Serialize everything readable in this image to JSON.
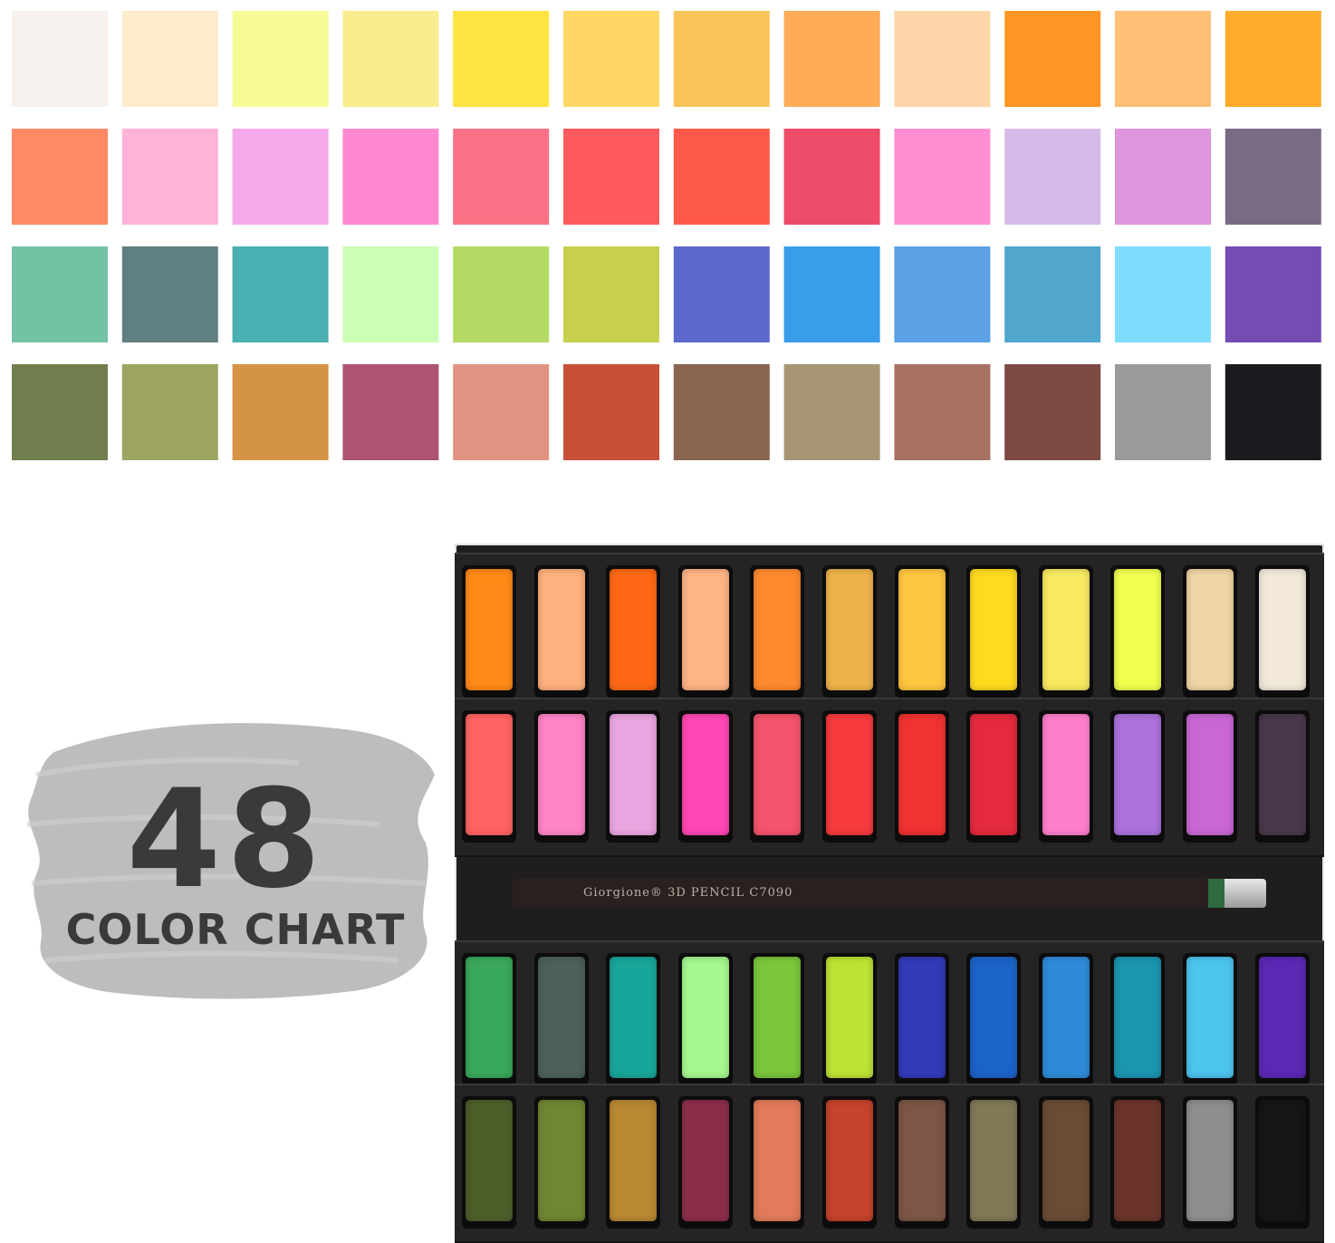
{
  "label": {
    "number": "48",
    "caption": "COLOR CHART",
    "pencil_text": "Giorgione® 3D PENCIL   C7090"
  },
  "colors": {
    "background": "#ffffff",
    "text": "#3a3a3a",
    "brush_stroke": "#bdbdbd",
    "tin": "#1f1d1e"
  },
  "chart_swatches": [
    [
      "#f6f1ec",
      "#fdebc9",
      "#f6fb98",
      "#fbed8f",
      "#ffe340",
      "#ffd762",
      "#f9c45a",
      "#ffab58",
      "#ffd6aa",
      "#ff9524",
      "#ffbf77",
      "#ffab2b"
    ],
    [
      "#ff8964",
      "#ffb3d7",
      "#f7aaeb",
      "#ff88d1",
      "#fb7286",
      "#ff5a5d",
      "#ff5a49",
      "#ee4b69",
      "#ff8fd2",
      "#d5bbe9",
      "#de95dc",
      "#7a6b84"
    ],
    [
      "#74c2a4",
      "#607f80",
      "#4aafb1",
      "#caffb5",
      "#b3db66",
      "#c8cf4d",
      "#5e69cc",
      "#399dea",
      "#5da1e6",
      "#50a6cd",
      "#7fdcff",
      "#744cb3"
    ],
    [
      "#707d4c",
      "#9ea461",
      "#d49345",
      "#ad5473",
      "#e29280",
      "#c95038",
      "#8a6550",
      "#a69673",
      "#a87263",
      "#7c4a43",
      "#9b9b9d",
      "#1b1a1f"
    ]
  ],
  "tin_pans": [
    [
      "#ff8a17",
      "#ffb17e",
      "#ff6915",
      "#ffb486",
      "#ff8a2e",
      "#eeb34b",
      "#ffc640",
      "#ffda1e",
      "#f8ea60",
      "#f1ff4f",
      "#f0d6a4",
      "#f2e9d9"
    ],
    [
      "#ff6462",
      "#ff85c6",
      "#e9a6e0",
      "#ff47b5",
      "#f5546c",
      "#f73a3e",
      "#f03332",
      "#e52a3e",
      "#ff7fcc",
      "#ad72dc",
      "#ca67d5",
      "#4a384a"
    ],
    [
      "#3aa85a",
      "#4d605b",
      "#19a69a",
      "#a6f88f",
      "#7ac63c",
      "#bde334",
      "#323ab8",
      "#1c63c8",
      "#2f8bd8",
      "#1c95b1",
      "#4cc5ef",
      "#5b28b3"
    ],
    [
      "#4e5e2a",
      "#6f8632",
      "#b98832",
      "#8c2e4a",
      "#e17b5b",
      "#c6432c",
      "#7d5645",
      "#807856",
      "#6a4c35",
      "#6b352b",
      "#8e8e8e",
      "#161616"
    ]
  ]
}
